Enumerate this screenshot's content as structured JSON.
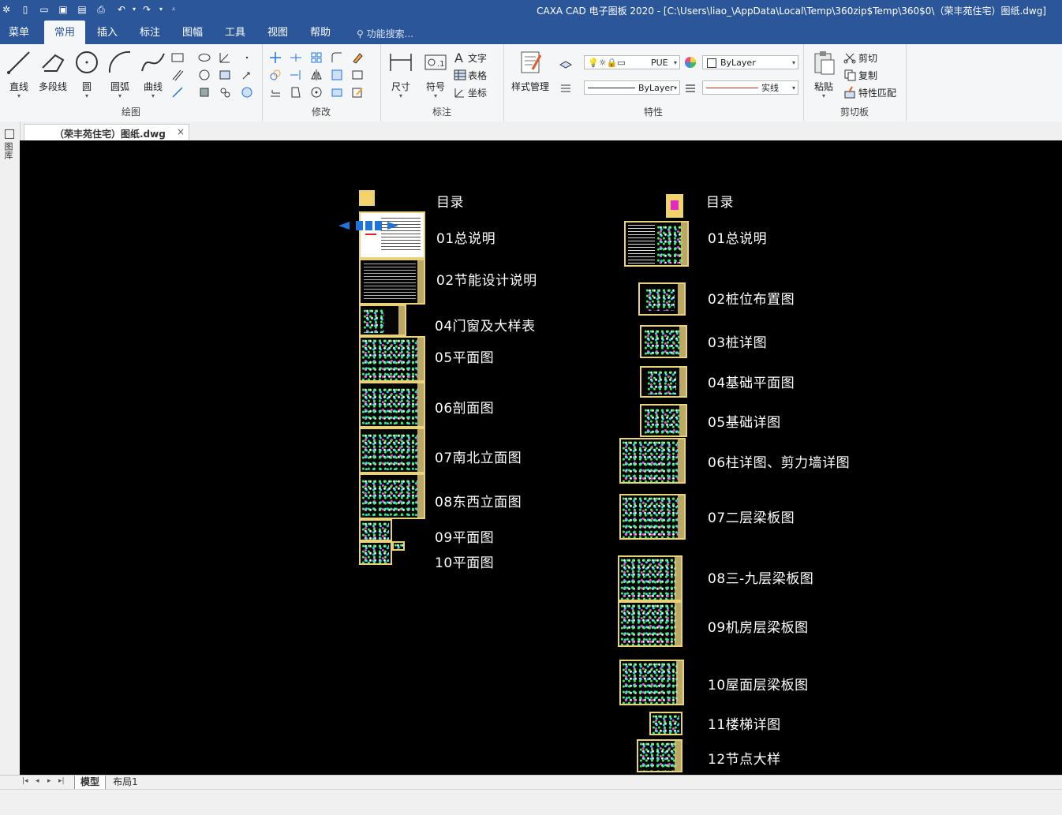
{
  "window": {
    "title": "CAXA CAD 电子图板 2020 - [C:\\Users\\liao_\\AppData\\Local\\Temp\\360zip$Temp\\360$0\\（荣丰苑住宅）图纸.dwg]"
  },
  "ribbon_tabs": [
    "菜单",
    "常用",
    "插入",
    "标注",
    "图幅",
    "工具",
    "视图",
    "帮助"
  ],
  "active_tab": "常用",
  "search": {
    "placeholder": "功能搜索..."
  },
  "groups": {
    "draw": {
      "label": "绘图",
      "buttons": [
        "直线",
        "多段线",
        "圆",
        "圆弧",
        "曲线"
      ]
    },
    "modify": {
      "label": "修改"
    },
    "annotate": {
      "label": "标注",
      "buttons": [
        "尺寸",
        "符号"
      ],
      "small": [
        "文字",
        "表格",
        "坐标"
      ]
    },
    "properties": {
      "label": "特性",
      "style_button": "样式管理",
      "layer_value": "PUE",
      "color_value": "ByLayer",
      "linetype_value": "ByLayer",
      "linewidth_value": "实线"
    },
    "clipboard": {
      "label": "剪切板",
      "paste": "粘贴",
      "cut": "剪切",
      "copy": "复制",
      "match": "特性匹配"
    }
  },
  "document_tab": {
    "label": "（荣丰苑住宅）图纸.dwg",
    "close": "×"
  },
  "left_strip": {
    "label": "图库"
  },
  "drawing": {
    "left_column": [
      {
        "label": "目录"
      },
      {
        "label": "01总说明"
      },
      {
        "label": "02节能设计说明"
      },
      {
        "label": "04门窗及大样表"
      },
      {
        "label": "05平面图"
      },
      {
        "label": "06剖面图"
      },
      {
        "label": "07南北立面图"
      },
      {
        "label": "08东西立面图"
      },
      {
        "label": "09平面图"
      },
      {
        "label": "10平面图"
      }
    ],
    "right_column": [
      {
        "label": "目录"
      },
      {
        "label": "01总说明"
      },
      {
        "label": "02桩位布置图"
      },
      {
        "label": "03桩详图"
      },
      {
        "label": "04基础平面图"
      },
      {
        "label": "05基础详图"
      },
      {
        "label": "06柱详图、剪力墙详图"
      },
      {
        "label": "07二层梁板图"
      },
      {
        "label": "08三-九层梁板图"
      },
      {
        "label": "09机房层梁板图"
      },
      {
        "label": "10屋面层梁板图"
      },
      {
        "label": "11楼梯详图"
      },
      {
        "label": "12节点大样"
      }
    ]
  },
  "layout_tabs": [
    "模型",
    "布局1"
  ],
  "colors": {
    "titlebar": "#2b579a",
    "canvas": "#000000",
    "sheet_border": "#e8d27a"
  }
}
